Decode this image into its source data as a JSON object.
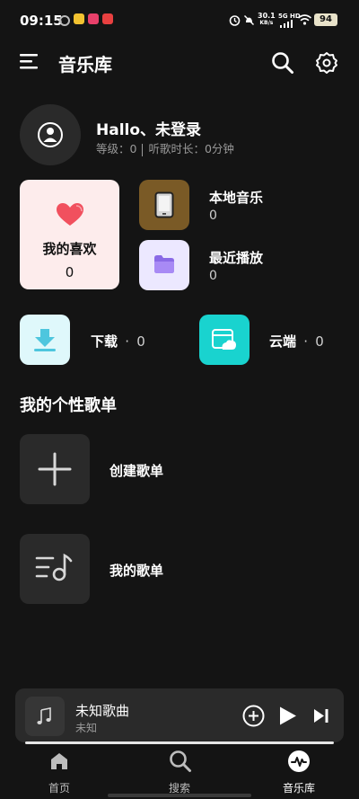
{
  "status_bar": {
    "time": "09:15",
    "speed_value": "30.1",
    "speed_unit": "KB/s",
    "network": "5G HD",
    "battery": "94"
  },
  "header": {
    "title": "音乐库",
    "icons": [
      "menu-icon",
      "search-icon",
      "settings-icon"
    ]
  },
  "user": {
    "greeting": "Hallo、未登录",
    "level_label": "等级：0",
    "listen_label": "听歌时长：0分钟"
  },
  "library": {
    "favorites": {
      "label": "我的喜欢",
      "count": "0",
      "bg": "#fdecec"
    },
    "local": {
      "label": "本地音乐",
      "count": "0",
      "color": "#7a5a26"
    },
    "recent": {
      "label": "最近播放",
      "count": "0",
      "color": "#ece8ff"
    },
    "download": {
      "label": "下载",
      "sep": "·",
      "count": "0",
      "color": "#dff8fb"
    },
    "cloud": {
      "label": "云端",
      "sep": "·",
      "count": "0",
      "color": "#19d3cf"
    }
  },
  "playlists": {
    "heading": "我的个性歌单",
    "create_label": "创建歌单",
    "mine_label": "我的歌单"
  },
  "player": {
    "song": "未知歌曲",
    "artist": "未知"
  },
  "nav": {
    "home": "首页",
    "search": "搜索",
    "library": "音乐库"
  }
}
